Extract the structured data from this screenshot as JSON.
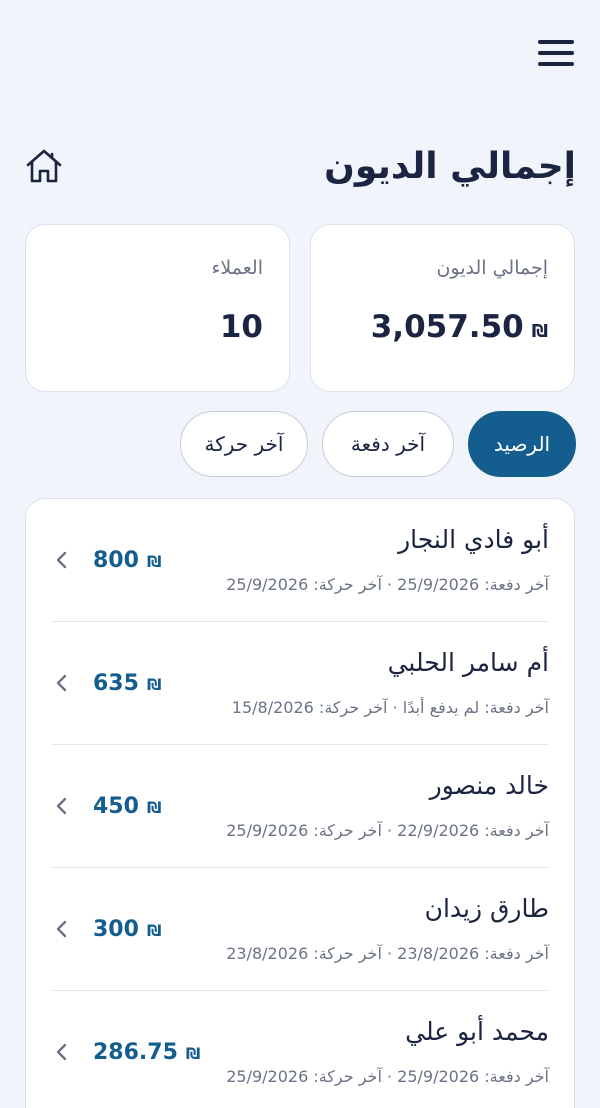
{
  "header": {
    "title": "إجمالي الديون"
  },
  "stats": {
    "total_debt": {
      "label": "إجمالي الديون",
      "value": "3,057.50",
      "currency": "₪"
    },
    "customers": {
      "label": "العملاء",
      "value": "10"
    }
  },
  "filters": [
    {
      "label": "الرصيد",
      "active": true
    },
    {
      "label": "آخر دفعة",
      "active": false
    },
    {
      "label": "آخر حركة",
      "active": false
    }
  ],
  "customers": [
    {
      "name": "أبو فادي النجار",
      "meta": "آخر دفعة: 25/9/2026 · آخر حركة: 25/9/2026",
      "amount": "800",
      "currency": "₪"
    },
    {
      "name": "أم سامر الحلبي",
      "meta": "آخر دفعة: لم يدفع أبدًا · آخر حركة: 15/8/2026",
      "amount": "635",
      "currency": "₪"
    },
    {
      "name": "خالد منصور",
      "meta": "آخر دفعة: 22/9/2026 · آخر حركة: 25/9/2026",
      "amount": "450",
      "currency": "₪"
    },
    {
      "name": "طارق زيدان",
      "meta": "آخر دفعة: 23/8/2026 · آخر حركة: 23/8/2026",
      "amount": "300",
      "currency": "₪"
    },
    {
      "name": "محمد أبو علي",
      "meta": "آخر دفعة: 25/9/2026 · آخر حركة: 25/9/2026",
      "amount": "286.75",
      "currency": "₪"
    }
  ],
  "icons": {
    "menu": "hamburger-menu-icon",
    "home": "home-icon",
    "row": "chevron-left-icon"
  },
  "colors": {
    "accent": "#135d8f",
    "background": "#f1f5fb",
    "text": "#1b2440",
    "muted": "#6b7385"
  }
}
